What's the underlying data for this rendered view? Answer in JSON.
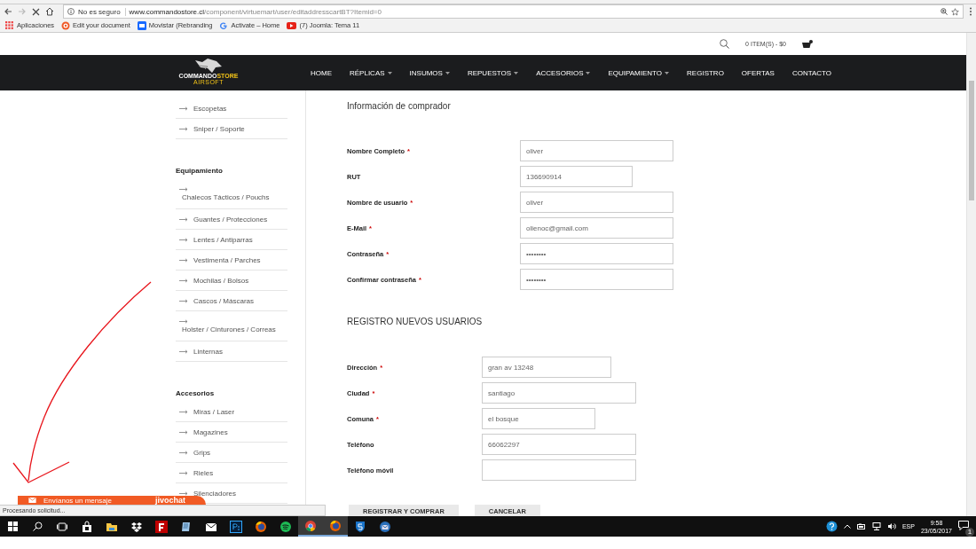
{
  "browser": {
    "address": {
      "security": "No es seguro",
      "domain": "www.commandostore.cl",
      "path": "/component/virtuemart/user/editaddresscartBT?Itemid=0"
    },
    "bookmarks": [
      {
        "kind": "apps",
        "label": "Aplicaciones"
      },
      {
        "kind": "target",
        "label": "Edit your document"
      },
      {
        "kind": "tile",
        "label": "Movistar (Rebranding"
      },
      {
        "kind": "google",
        "label": "Activate – Home"
      },
      {
        "kind": "video",
        "label": "(7) Joomla: Tema 11"
      }
    ]
  },
  "site": {
    "cart": "0 ITEM(S) - $0",
    "logo": {
      "first": "COMMANDO",
      "second": "STORE",
      "tag": "AIRSOFT"
    },
    "nav": [
      {
        "label": "HOME",
        "dropdown": false
      },
      {
        "label": "RÉPLICAS",
        "dropdown": true
      },
      {
        "label": "INSUMOS",
        "dropdown": true
      },
      {
        "label": "REPUESTOS",
        "dropdown": true
      },
      {
        "label": "ACCESORIOS",
        "dropdown": true
      },
      {
        "label": "EQUIPAMIENTO",
        "dropdown": true
      },
      {
        "label": "REGISTRO",
        "dropdown": false
      },
      {
        "label": "OFERTAS",
        "dropdown": false
      },
      {
        "label": "CONTACTO",
        "dropdown": false
      }
    ],
    "sidebar": [
      {
        "items": [
          {
            "label": "Escopetas",
            "kind": "inline"
          },
          {
            "label": "Sniper / Soporte",
            "kind": "inline"
          }
        ]
      },
      {
        "heading": "Equipamiento",
        "items": [
          {
            "label": "Chalecos Tácticos / Pouchs",
            "kind": "stacked"
          },
          {
            "label": "Guantes / Protecciones",
            "kind": "inline"
          },
          {
            "label": "Lentes / Antiparras",
            "kind": "inline"
          },
          {
            "label": "Vestimenta / Parches",
            "kind": "inline"
          },
          {
            "label": "Mochilas / Bolsos",
            "kind": "inline"
          },
          {
            "label": "Cascos / Máscaras",
            "kind": "inline"
          },
          {
            "label": "Holster / Cinturones / Correas",
            "kind": "stacked"
          },
          {
            "label": "Linternas",
            "kind": "inline"
          }
        ]
      },
      {
        "heading": "Accesorios",
        "items": [
          {
            "label": "Miras / Laser",
            "kind": "inline"
          },
          {
            "label": "Magazines",
            "kind": "inline"
          },
          {
            "label": "Grips",
            "kind": "inline"
          },
          {
            "label": "Rieles",
            "kind": "inline"
          },
          {
            "label": "Silenciadores",
            "kind": "inline"
          }
        ]
      }
    ],
    "form": [
      {
        "title": "Información de comprador",
        "fields": [
          {
            "label": "Nombre Completo",
            "mark": "*",
            "value": "oliver"
          },
          {
            "label": "RUT",
            "value": "136690914"
          },
          {
            "label": "Nombre de usuario",
            "mark": "*",
            "value": "oliver"
          },
          {
            "label": "E-Mail",
            "mark": "*",
            "value": "olienoc@gmail.com"
          },
          {
            "label": "Contraseña",
            "mark": "*",
            "value": "••••••••"
          },
          {
            "label": "Confirmar contraseña",
            "mark": "*",
            "value": "••••••••"
          }
        ]
      },
      {
        "title": "REGISTRO NUEVOS USUARIOS",
        "fields": [
          {
            "label": "Dirección",
            "mark": "*",
            "value": "gran av 13248"
          },
          {
            "label": "Ciudad",
            "mark": "*",
            "value": "santiago"
          },
          {
            "label": "Comuna",
            "mark": "*",
            "value": "el bosque"
          },
          {
            "label": "Teléfono",
            "value": "66062297"
          },
          {
            "label": "Teléfono móvil"
          }
        ]
      }
    ],
    "buttons": [
      "REGISTRAR Y COMPRAR",
      "CANCELAR"
    ],
    "chat": {
      "label": "Envíanos un mensaje",
      "brand": "jivochat"
    }
  },
  "status_bar": "Procesando solicitud...",
  "taskbar": {
    "apps": [
      {
        "kind": "store",
        "active": false
      },
      {
        "kind": "folder",
        "active": false
      },
      {
        "kind": "dropbox",
        "active": false
      },
      {
        "kind": "filezilla",
        "active": false
      },
      {
        "kind": "notes",
        "active": false
      },
      {
        "kind": "mail",
        "active": false
      },
      {
        "kind": "photoshop",
        "active": false
      },
      {
        "kind": "firefox",
        "active": false
      },
      {
        "kind": "spotify",
        "active": false
      },
      {
        "kind": "chrome",
        "active": true
      },
      {
        "kind": "firefox",
        "active": true
      },
      {
        "kind": "shield",
        "active": false
      },
      {
        "kind": "thunderbird",
        "active": false
      }
    ],
    "language": "ESP",
    "time": "9:58",
    "date": "23/05/2017",
    "notifications": "1"
  }
}
